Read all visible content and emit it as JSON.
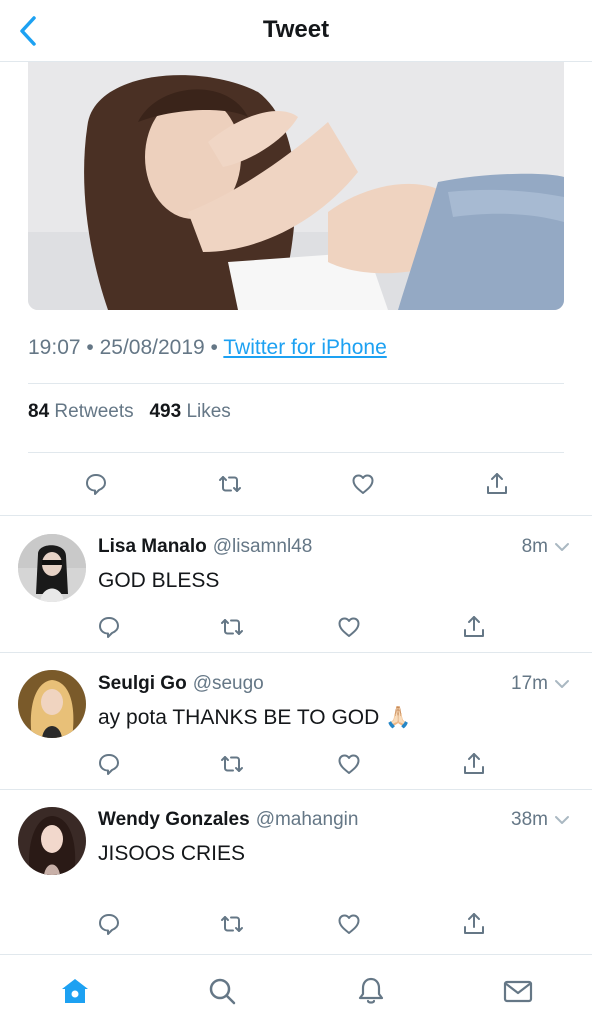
{
  "header": {
    "title": "Tweet"
  },
  "tweet": {
    "time": "19:07",
    "date": "25/08/2019",
    "source": "Twitter for iPhone",
    "retweets_count": "84",
    "retweets_label": "Retweets",
    "likes_count": "493",
    "likes_label": "Likes"
  },
  "replies": [
    {
      "name": "Lisa Manalo",
      "handle": "@lisamnl48",
      "time": "8m",
      "text": "GOD BLESS"
    },
    {
      "name": "Seulgi Go",
      "handle": "@seugo",
      "time": "17m",
      "text": "ay pota THANKS BE TO GOD 🙏🏻"
    },
    {
      "name": "Wendy Gonzales",
      "handle": "@mahangin",
      "time": "38m",
      "text": "JISOOS CRIES"
    }
  ],
  "tabs": [
    {
      "name": "home-icon",
      "active": true
    },
    {
      "name": "search-icon",
      "active": false
    },
    {
      "name": "notifications-icon",
      "active": false
    },
    {
      "name": "messages-icon",
      "active": false
    }
  ],
  "colors": {
    "accent": "#1da1f2",
    "icon_gray": "#657786",
    "text": "#14171a",
    "divider": "#e1e8ed"
  }
}
